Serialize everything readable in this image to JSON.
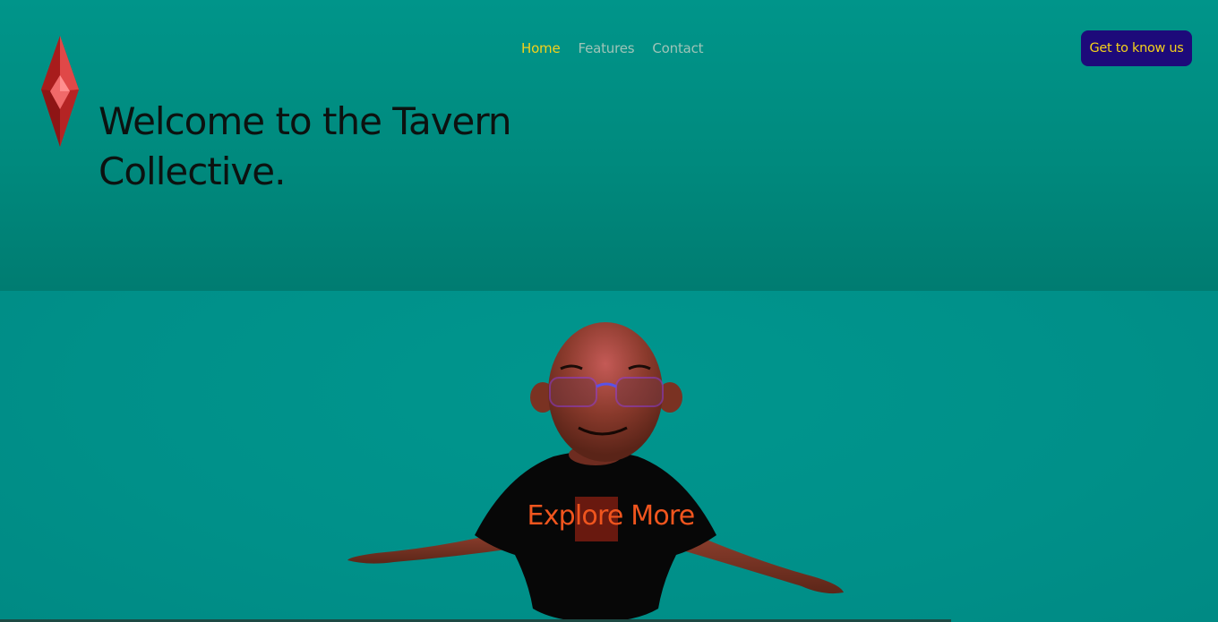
{
  "nav": {
    "items": [
      {
        "label": "Home",
        "active": true
      },
      {
        "label": "Features",
        "active": false
      },
      {
        "label": "Contact",
        "active": false
      }
    ]
  },
  "header": {
    "cta_label": "Get to know us"
  },
  "hero": {
    "title_line1": "Welcome to the Tavern",
    "title_line2": "Collective."
  },
  "stage": {
    "explore_label": "Explore More"
  },
  "colors": {
    "accent_yellow": "#f5d21a",
    "cta_bg": "#1d0a7a",
    "teal_bg": "#00968a",
    "explore_orange": "#f0551e"
  },
  "icons": {
    "logo": "red-crystal-icon"
  }
}
